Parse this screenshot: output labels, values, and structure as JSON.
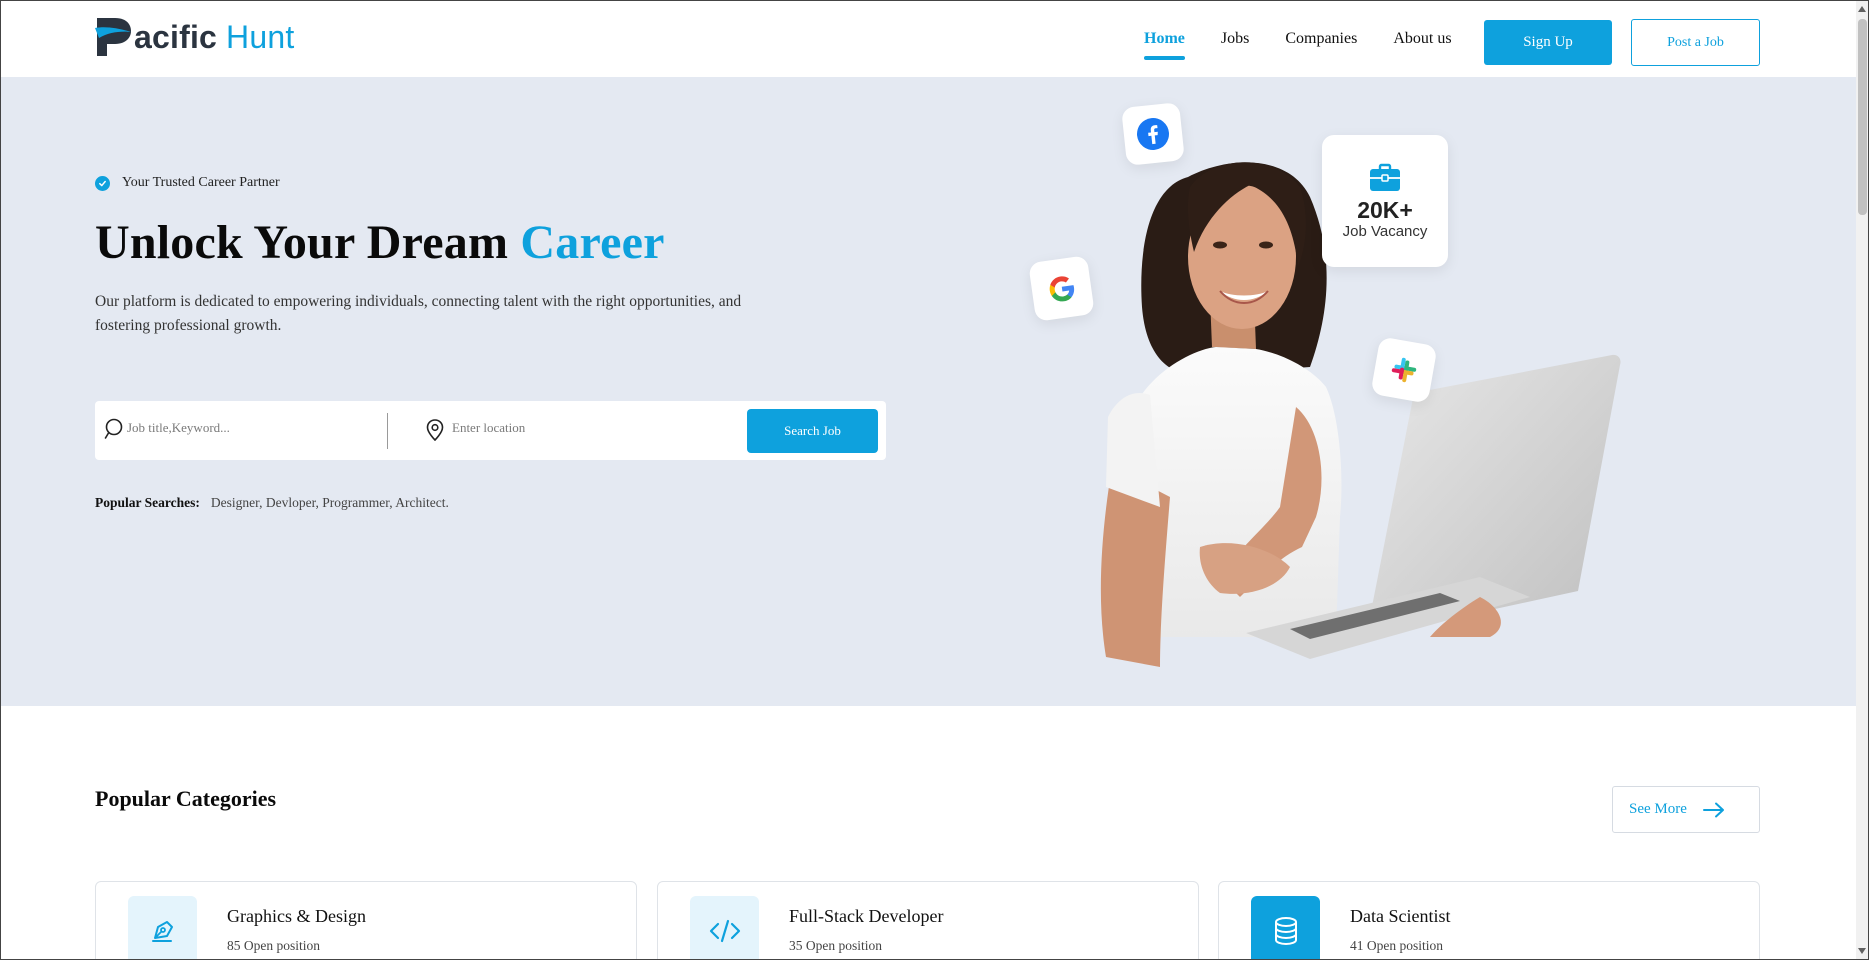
{
  "header": {
    "logo_part1": "Pacific",
    "logo_part1_visible": "acific",
    "logo_part2": "Hunt",
    "nav": [
      "Home",
      "Jobs",
      "Companies",
      "About us"
    ],
    "active_nav": "Home",
    "signup_label": "Sign Up",
    "post_job_label": "Post a Job"
  },
  "hero": {
    "badge": "Your Trusted Career Partner",
    "headline": "Unlock Your Dream",
    "headline_accent": "Career",
    "description": "Our platform is dedicated to empowering individuals, connecting talent with the right opportunities, and fostering professional growth.",
    "search": {
      "keyword_placeholder": "Job title,Keyword...",
      "location_placeholder": "Enter location",
      "button_label": "Search Job"
    },
    "popular_label": "Popular Searches:",
    "popular_terms": "Designer, Devloper, Programmer, Architect.",
    "stat_value": "20K+",
    "stat_label": "Job Vacancy",
    "brand_icons": [
      "facebook-icon",
      "google-icon",
      "slack-icon"
    ]
  },
  "categories": {
    "title": "Popular Categories",
    "see_more_label": "See More",
    "items": [
      {
        "name": "Graphics & Design",
        "open": "85 Open position",
        "icon": "pen-tool-icon"
      },
      {
        "name": "Full-Stack Developer",
        "open": "35 Open position",
        "icon": "code-icon"
      },
      {
        "name": "Data Scientist",
        "open": "41 Open position",
        "icon": "database-icon"
      }
    ]
  },
  "colors": {
    "accent": "#0ea1dd",
    "hero_bg": "#e4e9f2",
    "logo_dark": "#2b3440"
  }
}
